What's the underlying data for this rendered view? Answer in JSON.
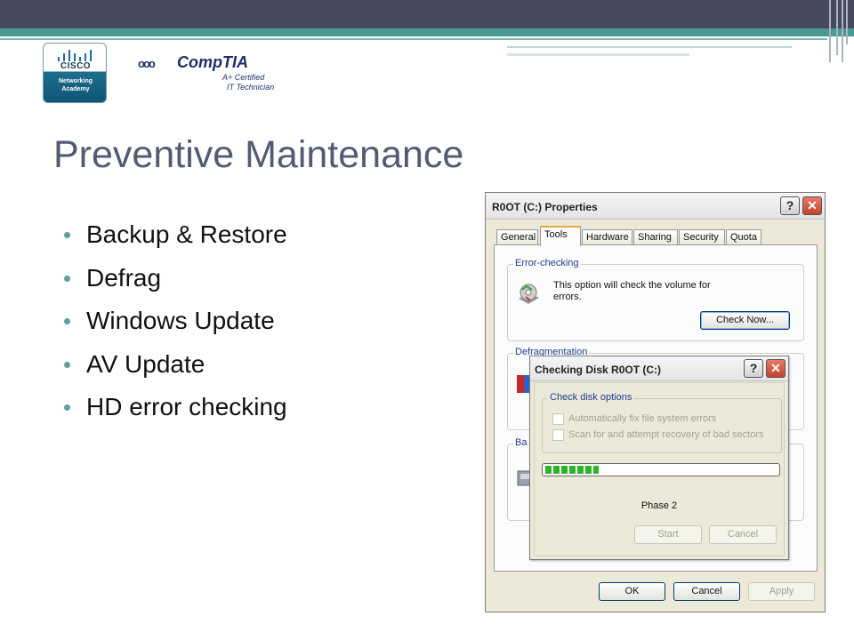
{
  "logos": {
    "cisco_word": "CISCO",
    "cisco_sub_line1": "Networking",
    "cisco_sub_line2": "Academy",
    "comptia_word": "CompTIA",
    "comptia_a_certified": "A+ Certified",
    "comptia_it_technician": "IT Technician"
  },
  "slide": {
    "title": "Preventive Maintenance",
    "bullets": [
      "Backup & Restore",
      "Defrag",
      "Windows Update",
      "AV Update",
      "HD error checking"
    ]
  },
  "properties_window": {
    "title": "R0OT (C:) Properties",
    "help_glyph": "?",
    "close_glyph": "✕",
    "tabs": [
      "General",
      "Tools",
      "Hardware",
      "Sharing",
      "Security",
      "Quota"
    ],
    "active_tab": "Tools",
    "error_checking": {
      "label": "Error-checking",
      "description_line1": "This option will check the volume for",
      "description_line2": "errors.",
      "button": "Check Now..."
    },
    "defrag_label": "Defragmentation",
    "backup_label": "Ba",
    "buttons": {
      "ok": "OK",
      "cancel": "Cancel",
      "apply": "Apply"
    }
  },
  "check_disk_dialog": {
    "title": "Checking Disk R0OT (C:)",
    "help_glyph": "?",
    "close_glyph": "✕",
    "group_label": "Check disk options",
    "options": [
      {
        "label": "Automatically fix file system errors",
        "checked": false
      },
      {
        "label": "Scan for and attempt recovery of bad sectors",
        "checked": false
      }
    ],
    "progress_fraction": 0.23,
    "status": "Phase 2",
    "buttons": {
      "start": "Start",
      "cancel": "Cancel"
    }
  },
  "colors": {
    "banner_dark": "#474a5e",
    "banner_teal": "#4a9a94",
    "title_color": "#545a72",
    "bullet_dot": "#5aa09b",
    "xp_face": "#ece9d8",
    "progress_green": "#2fb32f"
  },
  "icons": [
    "disk-check-icon",
    "defrag-icon",
    "backup-icon",
    "help-icon",
    "close-icon",
    "checkbox-icon"
  ]
}
